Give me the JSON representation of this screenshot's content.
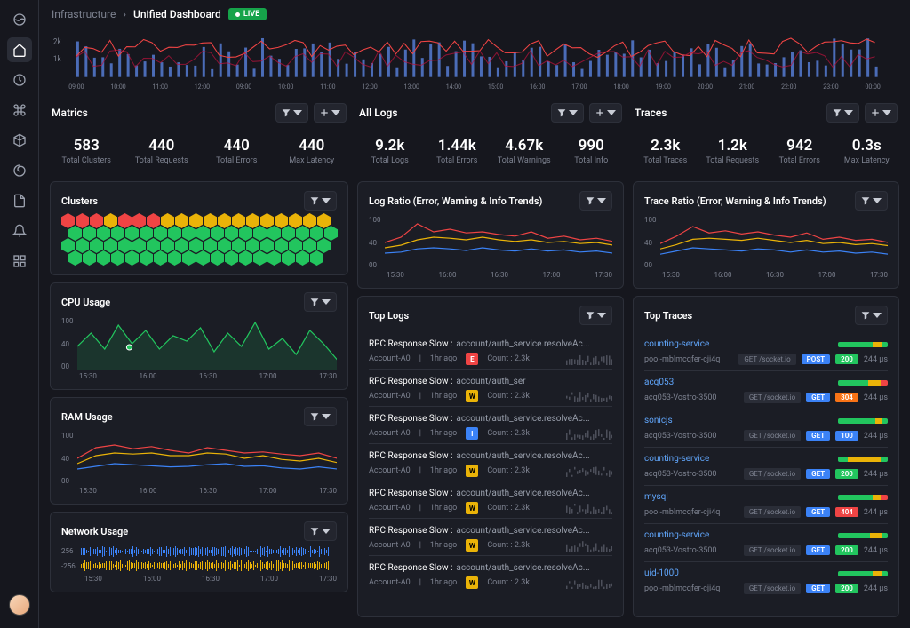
{
  "breadcrumb": {
    "root": "Infrastructure",
    "current": "Unified Dashboard",
    "live": "LIVE"
  },
  "sidebar": {
    "items": [
      "logo",
      "home",
      "clock",
      "command",
      "cube",
      "spiral",
      "file",
      "bell",
      "grid"
    ]
  },
  "timeline": {
    "y_ticks": [
      "2k",
      "1k"
    ],
    "x_ticks": [
      "09:00",
      "10:00",
      "11:00",
      "12:00",
      "09:00",
      "10:00",
      "11:00",
      "12:00",
      "13:00",
      "14:00",
      "15:00",
      "16:00",
      "17:00",
      "18:00",
      "19:00",
      "20:00",
      "21:00",
      "22:00",
      "23:00",
      "00:00"
    ]
  },
  "metrics": {
    "title": "Matrics",
    "stats": [
      {
        "v": "583",
        "l": "Total Clusters"
      },
      {
        "v": "440",
        "l": "Total Requests"
      },
      {
        "v": "440",
        "l": "Total Errors"
      },
      {
        "v": "440",
        "l": "Max Latency"
      }
    ],
    "clusters_title": "Clusters",
    "cpu_title": "CPU Usage",
    "ram_title": "RAM Usage",
    "net_title": "Network Usage",
    "axis_y": [
      "100",
      "40",
      "00"
    ],
    "axis_x": [
      "15:30",
      "16:00",
      "16:30",
      "17:00",
      "17:30"
    ],
    "net_y": [
      "256",
      "-256"
    ]
  },
  "logs": {
    "title": "All Logs",
    "stats": [
      {
        "v": "9.2k",
        "l": "Total Logs"
      },
      {
        "v": "1.44k",
        "l": "Total Errors"
      },
      {
        "v": "4.67k",
        "l": "Total Warnings"
      },
      {
        "v": "990",
        "l": "Total Info"
      }
    ],
    "ratio_title": "Log Ratio (Error, Warning & Info Trends)",
    "top_title": "Top Logs",
    "axis_y": [
      "100",
      "40",
      "00"
    ],
    "axis_x": [
      "15:30",
      "16:00",
      "16:30",
      "17:00",
      "17:30"
    ],
    "rows": [
      {
        "lbl": "RPC Response Slow :",
        "path": "account/auth_service.resolveAc...",
        "acct": "Account-A0",
        "age": "1hr ago",
        "lv": "E",
        "cnt": "Count : 2.3k"
      },
      {
        "lbl": "RPC Response Slow :",
        "path": "account/auth_ser",
        "acct": "Account-A0",
        "age": "1hr ago",
        "lv": "W",
        "cnt": "Count : 2.3k"
      },
      {
        "lbl": "RPC Response Slow :",
        "path": "account/auth_service.resolveAc...",
        "acct": "Account-A0",
        "age": "1hr ago",
        "lv": "I",
        "cnt": "Count : 2.3k"
      },
      {
        "lbl": "RPC Response Slow :",
        "path": "account/auth_service.resolveAc...",
        "acct": "Account-A0",
        "age": "1hr ago",
        "lv": "W",
        "cnt": "Count : 2.3k"
      },
      {
        "lbl": "RPC Response Slow :",
        "path": "account/auth_service.resolveAc...",
        "acct": "Account-A0",
        "age": "1hr ago",
        "lv": "W",
        "cnt": "Count : 2.3k"
      },
      {
        "lbl": "RPC Response Slow :",
        "path": "account/auth_service.resolveAc...",
        "acct": "Account-A0",
        "age": "1hr ago",
        "lv": "W",
        "cnt": "Count : 2.3k"
      },
      {
        "lbl": "RPC Response Slow :",
        "path": "account/auth_service.resolveAc...",
        "acct": "Account-A0",
        "age": "1hr ago",
        "lv": "W",
        "cnt": "Count : 2.3k"
      }
    ]
  },
  "traces": {
    "title": "Traces",
    "stats": [
      {
        "v": "2.3k",
        "l": "Total Traces"
      },
      {
        "v": "1.2k",
        "l": "Total Requests"
      },
      {
        "v": "942",
        "l": "Total Errors"
      },
      {
        "v": "0.3s",
        "l": "Max Latency"
      }
    ],
    "ratio_title": "Trace Ratio (Error, Warning & Info Trends)",
    "top_title": "Top Traces",
    "axis_y": [
      "100",
      "40",
      "00"
    ],
    "axis_x": [
      "15:30",
      "16:00",
      "16:30",
      "17:00",
      "17:30"
    ],
    "rows": [
      {
        "svc": "counting-service",
        "host": "pool-mblmcqfer-cji4q",
        "ep": "GET /socket.io",
        "m": "POST",
        "code": "200",
        "t": "244 μs",
        "bars": [
          [
            "g",
            70
          ],
          [
            "y",
            20
          ],
          [
            "g",
            10
          ]
        ]
      },
      {
        "svc": "acq053",
        "host": "acq053-Vostro-3500",
        "ep": "GET /socket.io",
        "m": "GET",
        "code": "304",
        "t": "244 μs",
        "bars": [
          [
            "g",
            60
          ],
          [
            "y",
            25
          ],
          [
            "r",
            15
          ]
        ]
      },
      {
        "svc": "sonicjs",
        "host": "acq053-Vostro-3500",
        "ep": "GET /socket.io",
        "m": "GET",
        "code": "100",
        "t": "244 μs",
        "bars": [
          [
            "g",
            75
          ],
          [
            "y",
            15
          ],
          [
            "g",
            10
          ]
        ]
      },
      {
        "svc": "counting-service",
        "host": "acq053-Vostro-3500",
        "ep": "GET /socket.io",
        "m": "GET",
        "code": "200",
        "t": "244 μs",
        "bars": [
          [
            "g",
            20
          ],
          [
            "y",
            65
          ],
          [
            "g",
            15
          ]
        ]
      },
      {
        "svc": "mysql",
        "host": "pool-mblmcqfer-cji4q",
        "ep": "GET /socket.io",
        "m": "GET",
        "code": "404",
        "t": "244 μs",
        "bars": [
          [
            "g",
            70
          ],
          [
            "y",
            15
          ],
          [
            "r",
            15
          ]
        ]
      },
      {
        "svc": "counting-service",
        "host": "acq053-Vostro-3500",
        "ep": "GET /socket.io",
        "m": "GET",
        "code": "200",
        "t": "244 μs",
        "bars": [
          [
            "g",
            65
          ],
          [
            "y",
            25
          ],
          [
            "g",
            10
          ]
        ]
      },
      {
        "svc": "uid-1000",
        "host": "pool-mblmcqfer-cji4q",
        "ep": "GET /socket.io",
        "m": "GET",
        "code": "200",
        "t": "244 μs",
        "bars": [
          [
            "g",
            70
          ],
          [
            "y",
            20
          ],
          [
            "g",
            10
          ]
        ]
      }
    ]
  },
  "chart_data": {
    "cpu": {
      "type": "line",
      "x": [
        "15:30",
        "16:00",
        "16:30",
        "17:00",
        "17:30"
      ],
      "ylim": [
        0,
        100
      ],
      "series": [
        {
          "name": "cpu",
          "values": [
            45,
            70,
            40,
            85,
            50,
            75,
            40,
            65,
            55,
            80,
            35,
            70,
            45,
            90,
            40,
            60,
            30,
            75,
            50,
            20
          ]
        }
      ]
    },
    "ram": {
      "type": "line",
      "x": [
        "15:30",
        "16:00",
        "16:30",
        "17:00",
        "17:30"
      ],
      "ylim": [
        0,
        100
      ],
      "series": [
        {
          "name": "err",
          "values": [
            50,
            70,
            75,
            68,
            72,
            65,
            60,
            70,
            65,
            60,
            62,
            58,
            55,
            60,
            50
          ]
        },
        {
          "name": "warn",
          "values": [
            40,
            55,
            60,
            58,
            60,
            55,
            55,
            60,
            58,
            50,
            55,
            48,
            45,
            50,
            42
          ]
        },
        {
          "name": "info",
          "values": [
            30,
            35,
            40,
            38,
            36,
            34,
            35,
            38,
            40,
            35,
            36,
            32,
            30,
            34,
            30
          ]
        }
      ]
    },
    "log_ratio": {
      "type": "line",
      "x": [
        "15:30",
        "16:00",
        "16:30",
        "17:00",
        "17:30"
      ],
      "ylim": [
        0,
        100
      ],
      "series": [
        {
          "name": "error",
          "values": [
            50,
            60,
            85,
            70,
            75,
            68,
            70,
            65,
            62,
            70,
            58,
            62,
            55,
            58,
            52
          ]
        },
        {
          "name": "warning",
          "values": [
            40,
            45,
            55,
            60,
            58,
            55,
            60,
            55,
            52,
            55,
            50,
            52,
            48,
            50,
            45
          ]
        },
        {
          "name": "info",
          "values": [
            30,
            32,
            38,
            40,
            38,
            35,
            40,
            36,
            34,
            38,
            34,
            36,
            32,
            34,
            30
          ]
        }
      ]
    },
    "trace_ratio": {
      "type": "line",
      "x": [
        "15:30",
        "16:00",
        "16:30",
        "17:00",
        "17:30"
      ],
      "ylim": [
        0,
        100
      ],
      "series": [
        {
          "name": "error",
          "values": [
            48,
            62,
            80,
            68,
            72,
            66,
            70,
            64,
            60,
            68,
            56,
            60,
            54,
            56,
            50
          ]
        },
        {
          "name": "warning",
          "values": [
            38,
            46,
            56,
            58,
            56,
            54,
            58,
            54,
            50,
            54,
            48,
            50,
            46,
            48,
            44
          ]
        },
        {
          "name": "info",
          "values": [
            28,
            34,
            40,
            38,
            36,
            34,
            38,
            36,
            32,
            36,
            32,
            34,
            30,
            32,
            28
          ]
        }
      ]
    },
    "clusters": {
      "green": 55,
      "yellow": 12,
      "red": 8
    }
  }
}
